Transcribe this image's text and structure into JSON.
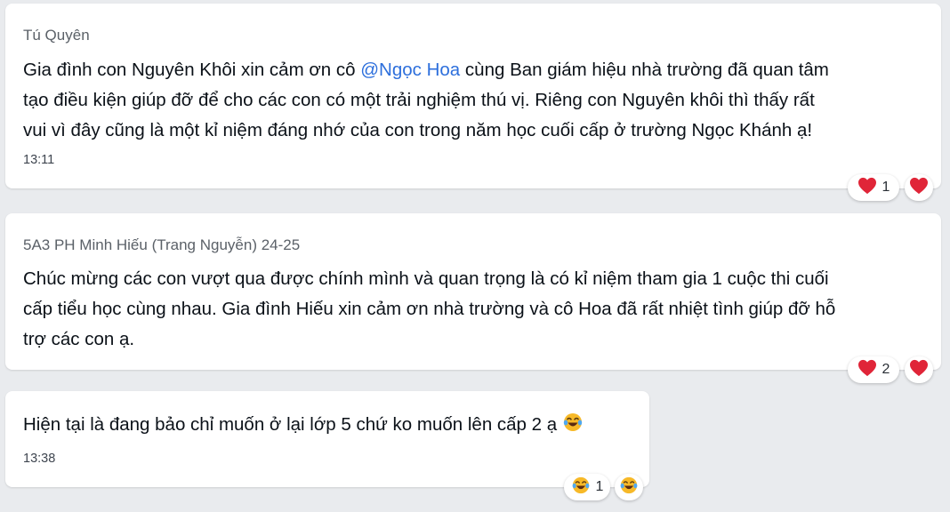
{
  "messages": [
    {
      "sender": "Tú Quyên",
      "lines": [
        {
          "before": "Gia đình con Nguyên Khôi xin cảm ơn cô ",
          "mention": "@Ngọc Hoa",
          "after": " cùng Ban giám hiệu nhà trường đã quan tâm"
        },
        "tạo điều kiện giúp đỡ để cho các con có một trải nghiệm thú vị. Riêng con Nguyên khôi thì thấy rất",
        "vui vì đây cũng là một kỉ niệm đáng nhớ của con trong năm học cuối cấp ở trường Ngọc Khánh ạ!"
      ],
      "time": "13:11",
      "reaction": {
        "icon": "heart-icon",
        "count": "1"
      },
      "quick_react_icon": "heart-icon"
    },
    {
      "sender": "5A3 PH Minh Hiếu (Trang Nguyễn) 24-25",
      "lines": [
        "Chúc mừng các con vượt qua được chính mình và quan trọng là có kỉ niệm tham gia 1 cuộc thi cuối",
        "cấp tiểu học cùng nhau. Gia đình Hiếu xin cảm ơn nhà trường và cô Hoa đã rất nhiệt tình giúp đỡ hỗ",
        "trợ các con ạ."
      ],
      "reaction": {
        "icon": "heart-icon",
        "count": "2"
      },
      "quick_react_icon": "heart-icon"
    },
    {
      "text": "Hiện tại là đang bảo chỉ muốn ở lại lớp 5 chứ ko muốn lên cấp 2 ạ",
      "text_emoji": "laughing-tears-emoji",
      "time": "13:38",
      "reaction": {
        "icon": "laughing-crying-icon",
        "count": "1"
      },
      "quick_react_icon": "laughing-crying-icon"
    }
  ],
  "colors": {
    "background": "#e9ebee",
    "mention": "#2d6fdc",
    "heart": "#e02538"
  }
}
